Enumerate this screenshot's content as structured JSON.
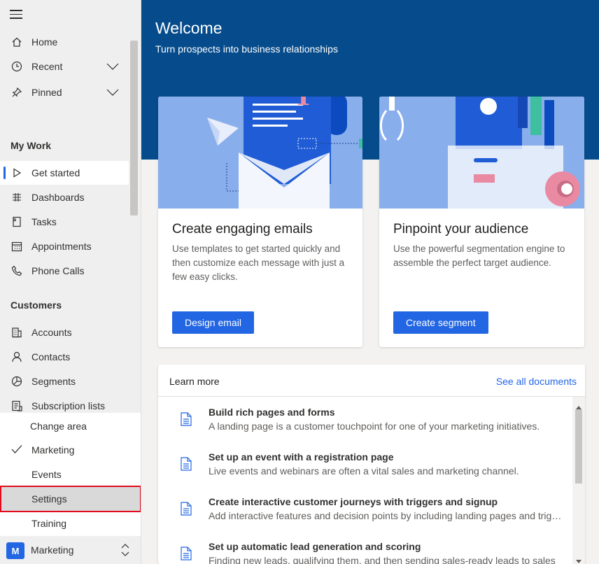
{
  "sidebar": {
    "top_items": [
      {
        "label": "Home",
        "icon": "home-icon"
      },
      {
        "label": "Recent",
        "icon": "clock-icon"
      },
      {
        "label": "Pinned",
        "icon": "pin-icon"
      }
    ],
    "sections": [
      {
        "title": "My Work",
        "items": [
          {
            "label": "Get started"
          },
          {
            "label": "Dashboards"
          },
          {
            "label": "Tasks"
          },
          {
            "label": "Appointments"
          },
          {
            "label": "Phone Calls"
          }
        ]
      },
      {
        "title": "Customers",
        "items": [
          {
            "label": "Accounts"
          },
          {
            "label": "Contacts"
          },
          {
            "label": "Segments"
          },
          {
            "label": "Subscription lists"
          }
        ]
      }
    ],
    "area_menu": {
      "title": "Change area",
      "items": [
        {
          "label": "Marketing"
        },
        {
          "label": "Events"
        },
        {
          "label": "Settings"
        },
        {
          "label": "Training"
        }
      ]
    },
    "area_switcher": {
      "badge": "M",
      "label": "Marketing"
    }
  },
  "hero": {
    "title": "Welcome",
    "subtitle": "Turn prospects into business relationships"
  },
  "cards": [
    {
      "title": "Create engaging emails",
      "text": "Use templates to get started quickly and then customize each message with just a few easy clicks.",
      "button": "Design email"
    },
    {
      "title": "Pinpoint your audience",
      "text": "Use the powerful segmentation engine to assemble the perfect target audience.",
      "button": "Create segment"
    }
  ],
  "learn_more": {
    "title": "Learn more",
    "link": "See all documents",
    "items": [
      {
        "title": "Build rich pages and forms",
        "desc": "A landing page is a customer touchpoint for one of your marketing initiatives."
      },
      {
        "title": "Set up an event with a registration page",
        "desc": "Live events and webinars are often a vital sales and marketing channel."
      },
      {
        "title": "Create interactive customer journeys with triggers and signup",
        "desc": "Add interactive features and decision points by including landing pages and triggers"
      },
      {
        "title": "Set up automatic lead generation and scoring",
        "desc": "Finding new leads, qualifying them, and then sending sales-ready leads to sales"
      }
    ]
  },
  "colors": {
    "accent": "#2266e3",
    "hero": "#064c8c",
    "illustration": "#89aeec",
    "selection_outline": "#e00b1c"
  }
}
